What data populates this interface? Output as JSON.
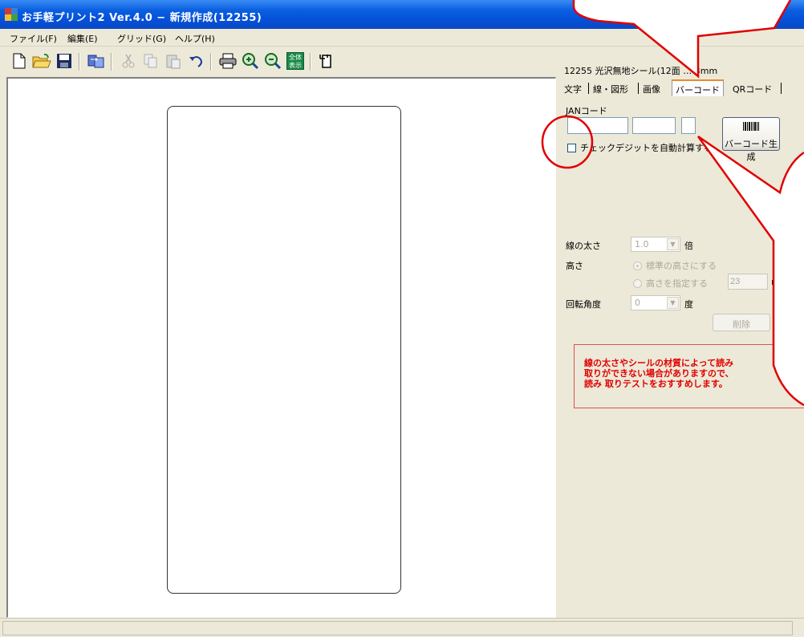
{
  "window": {
    "title": "お手軽プリント2 Ver.4.0 − 新規作成(12255)"
  },
  "menu": {
    "file": "ファイル(F)",
    "edit": "編集(E)",
    "grid": "グリッド(G)",
    "help": "ヘルプ(H)"
  },
  "toolbar": {
    "icons": [
      "new-doc-icon",
      "open-folder-icon",
      "save-icon",
      "import-icon",
      "cut-icon",
      "copy-icon",
      "paste-icon",
      "undo-icon",
      "print-icon",
      "zoom-in-icon",
      "zoom-out-icon",
      "fit-all-icon",
      "page-settings-icon"
    ],
    "fit_all_label": "全体\n表示"
  },
  "panel": {
    "paper_info": "12255 光沢無地シール(12面 … 3mm",
    "tabs": [
      "文字",
      "線・図形",
      "画像",
      "バーコード",
      "QRコード"
    ],
    "active_tab": "バーコード",
    "jan_label": "JANコード",
    "jan_fields": [
      "",
      "",
      ""
    ],
    "generate_button": "バーコード生成",
    "checkdigit_label": "チェックデジットを自動計算する",
    "line_width_label": "線の太さ",
    "line_width_value": "1.0",
    "line_width_unit": "倍",
    "height_label": "高さ",
    "height_opt_standard": "標準の高さにする",
    "height_opt_custom": "高さを指定する",
    "height_value": "23",
    "height_unit": "m",
    "rotation_label": "回転角度",
    "rotation_value": "0",
    "rotation_unit": "度",
    "delete_button": "削除",
    "warning_line1": "線の太さやシールの材質によって読み",
    "warning_line2": "取りができない場合がありますので、",
    "warning_line3": "読み 取りテストをおすすめします。"
  },
  "colors": {
    "titlebar": "#0a5fe0",
    "callout": "#e00000",
    "warning_text": "#e00000"
  }
}
